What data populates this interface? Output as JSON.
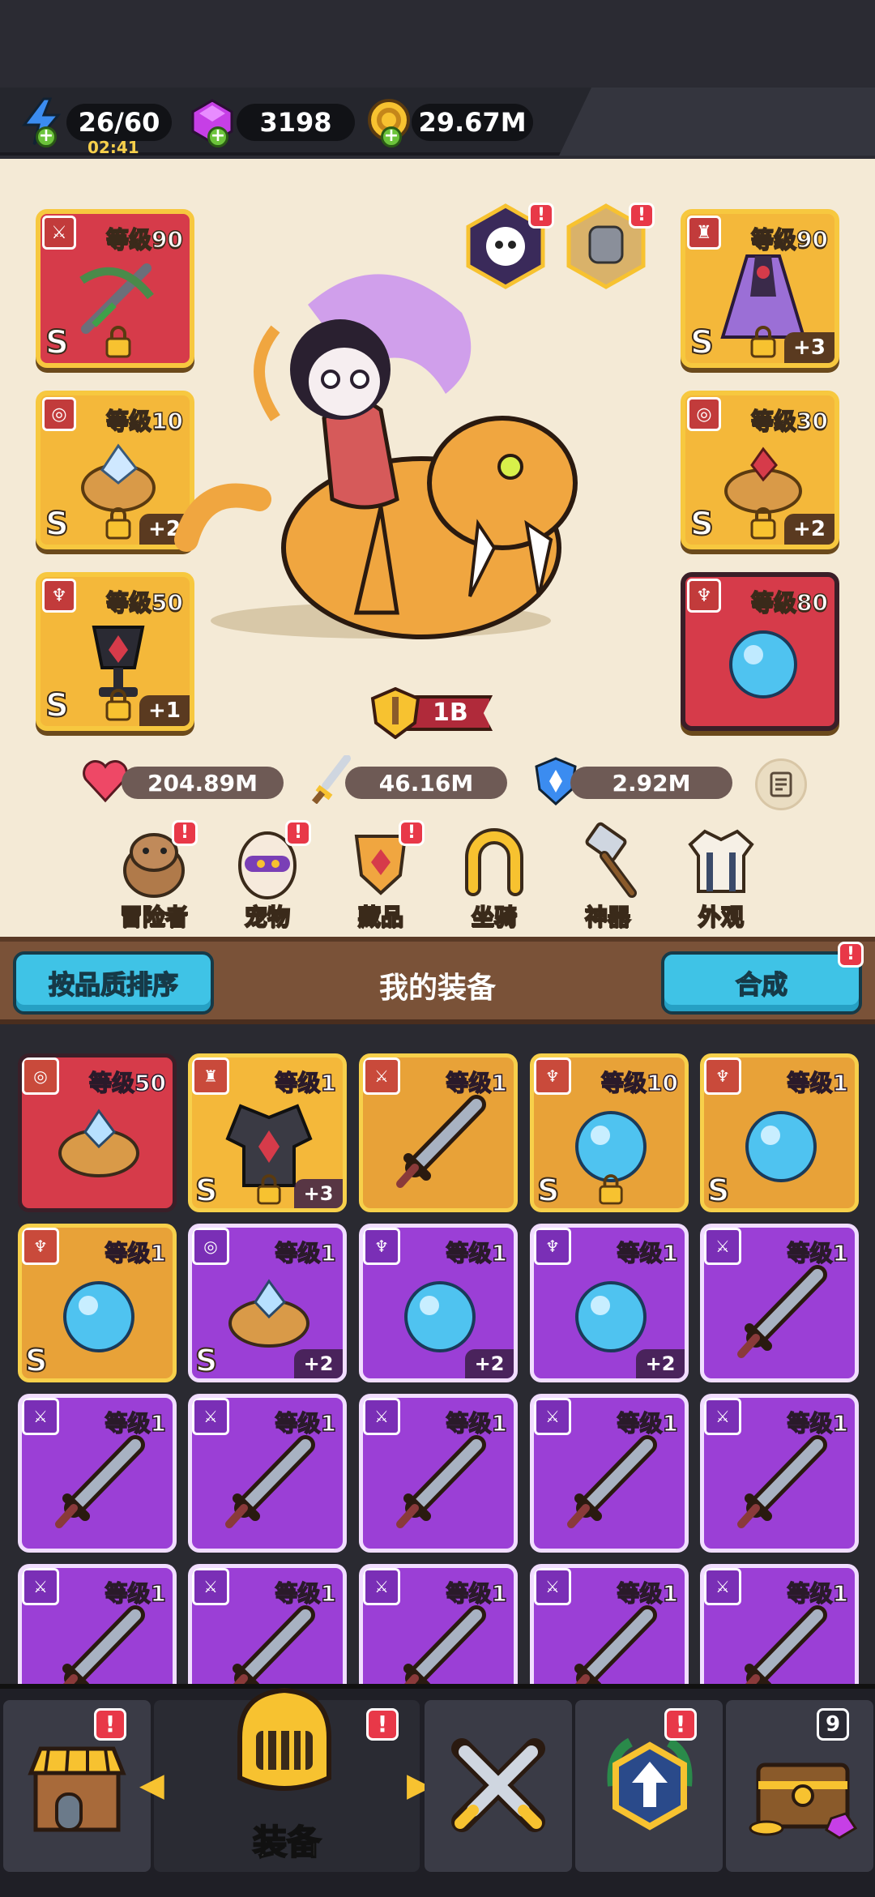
{
  "currency": {
    "energy": {
      "value": "26/60",
      "timer": "02:41"
    },
    "gems": {
      "value": "3198"
    },
    "gold": {
      "value": "29.67M"
    }
  },
  "hero_slots": [
    {
      "slot": "weapon",
      "level": "等级90",
      "grade": "S",
      "locked": true,
      "plus": ""
    },
    {
      "slot": "ring",
      "level": "等级10",
      "grade": "S",
      "locked": true,
      "plus": "+2"
    },
    {
      "slot": "necklace",
      "level": "等级50",
      "grade": "S",
      "locked": true,
      "plus": "+1"
    },
    {
      "slot": "armor",
      "level": "等级90",
      "grade": "S",
      "locked": true,
      "plus": "+3"
    },
    {
      "slot": "ring",
      "level": "等级30",
      "grade": "S",
      "locked": true,
      "plus": "+2"
    },
    {
      "slot": "necklace",
      "level": "等级80",
      "grade": "",
      "locked": false,
      "plus": ""
    }
  ],
  "power": "1B",
  "stats": {
    "hp": "204.89M",
    "attack": "46.16M",
    "defense": "2.92M"
  },
  "categories": [
    {
      "label": "冒险者",
      "icon": "capybara-icon",
      "alert": "!"
    },
    {
      "label": "宠物",
      "icon": "egg-pet-icon",
      "alert": "!"
    },
    {
      "label": "藏品",
      "icon": "shield-collection-icon",
      "alert": "!"
    },
    {
      "label": "坐骑",
      "icon": "horseshoe-icon",
      "alert": ""
    },
    {
      "label": "神器",
      "icon": "hammer-icon",
      "alert": ""
    },
    {
      "label": "外观",
      "icon": "outfit-icon",
      "alert": ""
    }
  ],
  "equipment": {
    "sort_button": "按品质排序",
    "title": "我的装备",
    "merge_button": "合成",
    "merge_alert": "!"
  },
  "grid": [
    {
      "type": "ring",
      "level": "等级50",
      "grade": "",
      "plus": "",
      "rarity": "red",
      "locked": false
    },
    {
      "type": "armor",
      "level": "等级1",
      "grade": "S",
      "plus": "+3",
      "rarity": "gold",
      "locked": true
    },
    {
      "type": "weapon",
      "level": "等级1",
      "grade": "",
      "plus": "",
      "rarity": "orange",
      "locked": false
    },
    {
      "type": "necklace",
      "level": "等级10",
      "grade": "S",
      "plus": "",
      "rarity": "orange",
      "locked": true
    },
    {
      "type": "necklace",
      "level": "等级1",
      "grade": "S",
      "plus": "",
      "rarity": "orange",
      "locked": false
    },
    {
      "type": "necklace",
      "level": "等级1",
      "grade": "S",
      "plus": "",
      "rarity": "orange",
      "locked": false
    },
    {
      "type": "ring",
      "level": "等级1",
      "grade": "S",
      "plus": "+2",
      "rarity": "purple",
      "locked": false
    },
    {
      "type": "necklace",
      "level": "等级1",
      "grade": "",
      "plus": "+2",
      "rarity": "purple",
      "locked": false
    },
    {
      "type": "necklace",
      "level": "等级1",
      "grade": "",
      "plus": "+2",
      "rarity": "purple",
      "locked": false
    },
    {
      "type": "weapon",
      "level": "等级1",
      "grade": "",
      "plus": "",
      "rarity": "purple",
      "locked": false
    },
    {
      "type": "weapon",
      "level": "等级1",
      "grade": "",
      "plus": "",
      "rarity": "purple",
      "locked": false
    },
    {
      "type": "weapon",
      "level": "等级1",
      "grade": "",
      "plus": "",
      "rarity": "purple",
      "locked": false
    },
    {
      "type": "weapon",
      "level": "等级1",
      "grade": "",
      "plus": "",
      "rarity": "purple",
      "locked": false
    },
    {
      "type": "weapon",
      "level": "等级1",
      "grade": "",
      "plus": "",
      "rarity": "purple",
      "locked": false
    },
    {
      "type": "weapon",
      "level": "等级1",
      "grade": "",
      "plus": "",
      "rarity": "purple",
      "locked": false
    },
    {
      "type": "weapon",
      "level": "等级1",
      "grade": "",
      "plus": "",
      "rarity": "purple",
      "locked": false
    },
    {
      "type": "weapon",
      "level": "等级1",
      "grade": "",
      "plus": "",
      "rarity": "purple",
      "locked": false
    },
    {
      "type": "weapon",
      "level": "等级1",
      "grade": "",
      "plus": "",
      "rarity": "purple",
      "locked": false
    },
    {
      "type": "weapon",
      "level": "等级1",
      "grade": "",
      "plus": "",
      "rarity": "purple",
      "locked": false
    },
    {
      "type": "weapon",
      "level": "等级1",
      "grade": "",
      "plus": "",
      "rarity": "purple",
      "locked": false
    }
  ],
  "nav": {
    "active_label": "装备",
    "chest_count": "9",
    "alert": "!"
  },
  "colors": {
    "rarity_red": "#d63b4a",
    "rarity_gold": "#f4b83a",
    "rarity_purple": "#9b3fd6",
    "accent_cyan": "#3fc3e6"
  }
}
